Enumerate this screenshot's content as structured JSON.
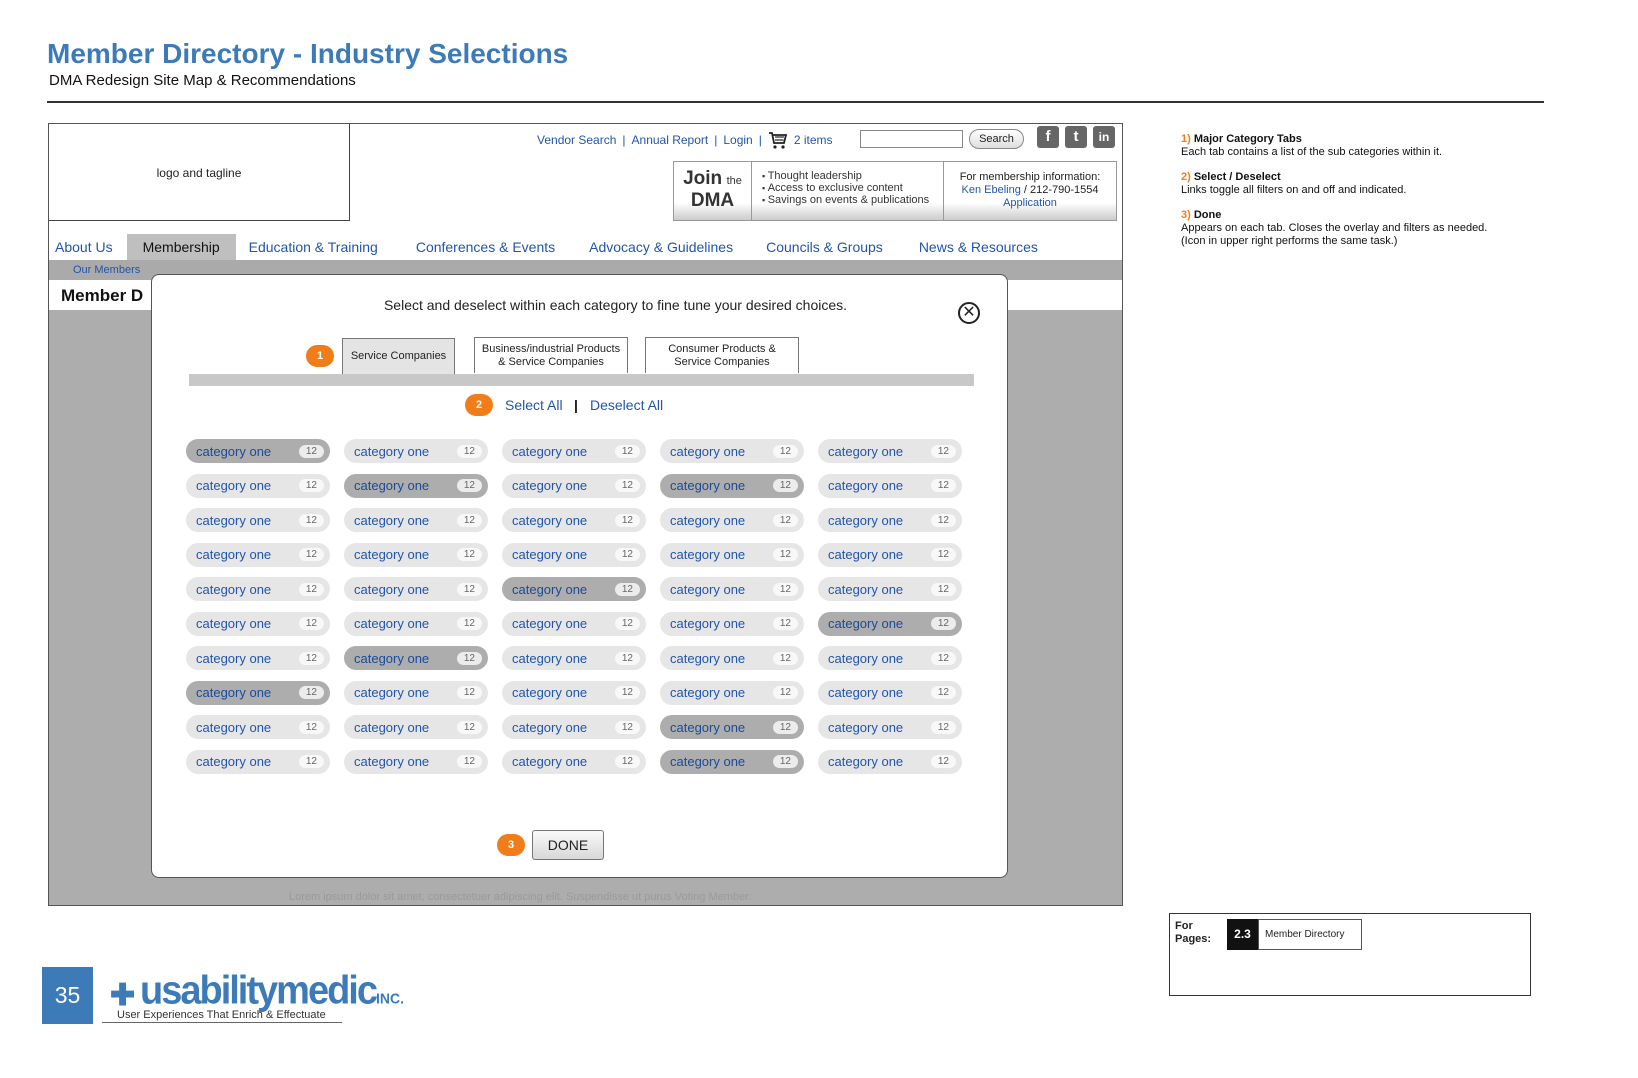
{
  "doc": {
    "title": "Member Directory -  Industry Selections",
    "subtitle": "DMA Redesign Site Map & Recommendations"
  },
  "site": {
    "logo_text": "logo and tagline",
    "util_links": [
      "Vendor Search",
      "Annual Report",
      "Login"
    ],
    "cart_text": "2 items",
    "search_button": "Search",
    "join": {
      "join": "Join",
      "the": "the",
      "dma": "DMA",
      "bullets": [
        "Thought leadership",
        "Access to exclusive content",
        "Savings on events & publications"
      ],
      "info_label": "For membership information:",
      "contact_name": "Ken Ebeling",
      "contact_phone": " / 212-790-1554",
      "application": "Application"
    },
    "nav": [
      "About Us",
      "Membership",
      "Education & Training",
      "Conferences & Events",
      "Advocacy & Guidelines",
      "Councils & Groups",
      "News & Resources"
    ],
    "crumb": "Our Members",
    "page_heading": "Member D",
    "lorem": "Lorem ipsum dolor sit amet, consectetuer adipiscing elit. Suspendisse ut purus      Voting Member:"
  },
  "modal": {
    "instructions": "Select and deselect within each category to fine tune your desired choices.",
    "close_symbol": "✕",
    "badges": [
      "1",
      "2",
      "3"
    ],
    "tabs": [
      {
        "line1": "Service Companies",
        "line2": ""
      },
      {
        "line1": "Business/industrial Products",
        "line2": "& Service Companies"
      },
      {
        "line1": "Consumer Products &",
        "line2": "Service Companies"
      }
    ],
    "select_all": "Select All",
    "separator": "|",
    "deselect_all": "Deselect All",
    "done": "DONE",
    "category_label": "category one",
    "category_count": "12",
    "selected_grid": [
      [
        1,
        0,
        0,
        0,
        0
      ],
      [
        0,
        1,
        0,
        1,
        0
      ],
      [
        0,
        0,
        0,
        0,
        0
      ],
      [
        0,
        0,
        0,
        0,
        0
      ],
      [
        0,
        0,
        1,
        0,
        0
      ],
      [
        0,
        0,
        0,
        0,
        1
      ],
      [
        0,
        1,
        0,
        0,
        0
      ],
      [
        1,
        0,
        0,
        0,
        0
      ],
      [
        0,
        0,
        0,
        1,
        0
      ],
      [
        0,
        0,
        0,
        1,
        0
      ]
    ]
  },
  "notes": [
    {
      "num": "1)",
      "heading": "Major Category Tabs",
      "text": "Each tab contains a list of the sub categories within it."
    },
    {
      "num": "2)",
      "heading": "Select / Deselect",
      "text": "Links toggle all filters on and off and indicated."
    },
    {
      "num": "3)",
      "heading": "Done",
      "text": "Appears on each tab.  Closes the overlay and filters as needed. (Icon in upper right performs the same task.)"
    }
  ],
  "for_pages": {
    "label": "For Pages:",
    "page_number": "2.3",
    "page_name": "Member Directory"
  },
  "footer": {
    "page_number": "35",
    "brand": "usabilitymedic",
    "brand_suffix": "INC.",
    "tagline": "User Experiences That Enrich & Effectuate"
  },
  "colors": {
    "title_blue": "#3d7ab8",
    "link_blue": "#2255aa",
    "badge_orange": "#f07d1a"
  }
}
